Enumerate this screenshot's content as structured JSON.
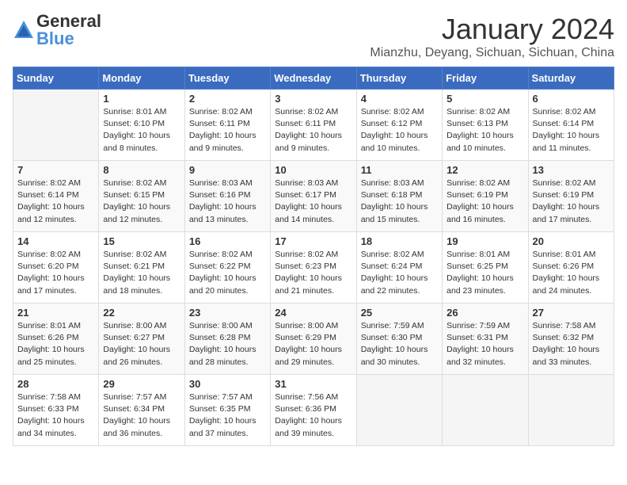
{
  "header": {
    "logo_general": "General",
    "logo_blue": "Blue",
    "month_title": "January 2024",
    "location": "Mianzhu, Deyang, Sichuan, Sichuan, China"
  },
  "weekdays": [
    "Sunday",
    "Monday",
    "Tuesday",
    "Wednesday",
    "Thursday",
    "Friday",
    "Saturday"
  ],
  "weeks": [
    [
      {
        "day": "",
        "sunrise": "",
        "sunset": "",
        "daylight": ""
      },
      {
        "day": "1",
        "sunrise": "Sunrise: 8:01 AM",
        "sunset": "Sunset: 6:10 PM",
        "daylight": "Daylight: 10 hours and 8 minutes."
      },
      {
        "day": "2",
        "sunrise": "Sunrise: 8:02 AM",
        "sunset": "Sunset: 6:11 PM",
        "daylight": "Daylight: 10 hours and 9 minutes."
      },
      {
        "day": "3",
        "sunrise": "Sunrise: 8:02 AM",
        "sunset": "Sunset: 6:11 PM",
        "daylight": "Daylight: 10 hours and 9 minutes."
      },
      {
        "day": "4",
        "sunrise": "Sunrise: 8:02 AM",
        "sunset": "Sunset: 6:12 PM",
        "daylight": "Daylight: 10 hours and 10 minutes."
      },
      {
        "day": "5",
        "sunrise": "Sunrise: 8:02 AM",
        "sunset": "Sunset: 6:13 PM",
        "daylight": "Daylight: 10 hours and 10 minutes."
      },
      {
        "day": "6",
        "sunrise": "Sunrise: 8:02 AM",
        "sunset": "Sunset: 6:14 PM",
        "daylight": "Daylight: 10 hours and 11 minutes."
      }
    ],
    [
      {
        "day": "7",
        "sunrise": "Sunrise: 8:02 AM",
        "sunset": "Sunset: 6:14 PM",
        "daylight": "Daylight: 10 hours and 12 minutes."
      },
      {
        "day": "8",
        "sunrise": "Sunrise: 8:02 AM",
        "sunset": "Sunset: 6:15 PM",
        "daylight": "Daylight: 10 hours and 12 minutes."
      },
      {
        "day": "9",
        "sunrise": "Sunrise: 8:03 AM",
        "sunset": "Sunset: 6:16 PM",
        "daylight": "Daylight: 10 hours and 13 minutes."
      },
      {
        "day": "10",
        "sunrise": "Sunrise: 8:03 AM",
        "sunset": "Sunset: 6:17 PM",
        "daylight": "Daylight: 10 hours and 14 minutes."
      },
      {
        "day": "11",
        "sunrise": "Sunrise: 8:03 AM",
        "sunset": "Sunset: 6:18 PM",
        "daylight": "Daylight: 10 hours and 15 minutes."
      },
      {
        "day": "12",
        "sunrise": "Sunrise: 8:02 AM",
        "sunset": "Sunset: 6:19 PM",
        "daylight": "Daylight: 10 hours and 16 minutes."
      },
      {
        "day": "13",
        "sunrise": "Sunrise: 8:02 AM",
        "sunset": "Sunset: 6:19 PM",
        "daylight": "Daylight: 10 hours and 17 minutes."
      }
    ],
    [
      {
        "day": "14",
        "sunrise": "Sunrise: 8:02 AM",
        "sunset": "Sunset: 6:20 PM",
        "daylight": "Daylight: 10 hours and 17 minutes."
      },
      {
        "day": "15",
        "sunrise": "Sunrise: 8:02 AM",
        "sunset": "Sunset: 6:21 PM",
        "daylight": "Daylight: 10 hours and 18 minutes."
      },
      {
        "day": "16",
        "sunrise": "Sunrise: 8:02 AM",
        "sunset": "Sunset: 6:22 PM",
        "daylight": "Daylight: 10 hours and 20 minutes."
      },
      {
        "day": "17",
        "sunrise": "Sunrise: 8:02 AM",
        "sunset": "Sunset: 6:23 PM",
        "daylight": "Daylight: 10 hours and 21 minutes."
      },
      {
        "day": "18",
        "sunrise": "Sunrise: 8:02 AM",
        "sunset": "Sunset: 6:24 PM",
        "daylight": "Daylight: 10 hours and 22 minutes."
      },
      {
        "day": "19",
        "sunrise": "Sunrise: 8:01 AM",
        "sunset": "Sunset: 6:25 PM",
        "daylight": "Daylight: 10 hours and 23 minutes."
      },
      {
        "day": "20",
        "sunrise": "Sunrise: 8:01 AM",
        "sunset": "Sunset: 6:26 PM",
        "daylight": "Daylight: 10 hours and 24 minutes."
      }
    ],
    [
      {
        "day": "21",
        "sunrise": "Sunrise: 8:01 AM",
        "sunset": "Sunset: 6:26 PM",
        "daylight": "Daylight: 10 hours and 25 minutes."
      },
      {
        "day": "22",
        "sunrise": "Sunrise: 8:00 AM",
        "sunset": "Sunset: 6:27 PM",
        "daylight": "Daylight: 10 hours and 26 minutes."
      },
      {
        "day": "23",
        "sunrise": "Sunrise: 8:00 AM",
        "sunset": "Sunset: 6:28 PM",
        "daylight": "Daylight: 10 hours and 28 minutes."
      },
      {
        "day": "24",
        "sunrise": "Sunrise: 8:00 AM",
        "sunset": "Sunset: 6:29 PM",
        "daylight": "Daylight: 10 hours and 29 minutes."
      },
      {
        "day": "25",
        "sunrise": "Sunrise: 7:59 AM",
        "sunset": "Sunset: 6:30 PM",
        "daylight": "Daylight: 10 hours and 30 minutes."
      },
      {
        "day": "26",
        "sunrise": "Sunrise: 7:59 AM",
        "sunset": "Sunset: 6:31 PM",
        "daylight": "Daylight: 10 hours and 32 minutes."
      },
      {
        "day": "27",
        "sunrise": "Sunrise: 7:58 AM",
        "sunset": "Sunset: 6:32 PM",
        "daylight": "Daylight: 10 hours and 33 minutes."
      }
    ],
    [
      {
        "day": "28",
        "sunrise": "Sunrise: 7:58 AM",
        "sunset": "Sunset: 6:33 PM",
        "daylight": "Daylight: 10 hours and 34 minutes."
      },
      {
        "day": "29",
        "sunrise": "Sunrise: 7:57 AM",
        "sunset": "Sunset: 6:34 PM",
        "daylight": "Daylight: 10 hours and 36 minutes."
      },
      {
        "day": "30",
        "sunrise": "Sunrise: 7:57 AM",
        "sunset": "Sunset: 6:35 PM",
        "daylight": "Daylight: 10 hours and 37 minutes."
      },
      {
        "day": "31",
        "sunrise": "Sunrise: 7:56 AM",
        "sunset": "Sunset: 6:36 PM",
        "daylight": "Daylight: 10 hours and 39 minutes."
      },
      {
        "day": "",
        "sunrise": "",
        "sunset": "",
        "daylight": ""
      },
      {
        "day": "",
        "sunrise": "",
        "sunset": "",
        "daylight": ""
      },
      {
        "day": "",
        "sunrise": "",
        "sunset": "",
        "daylight": ""
      }
    ]
  ]
}
